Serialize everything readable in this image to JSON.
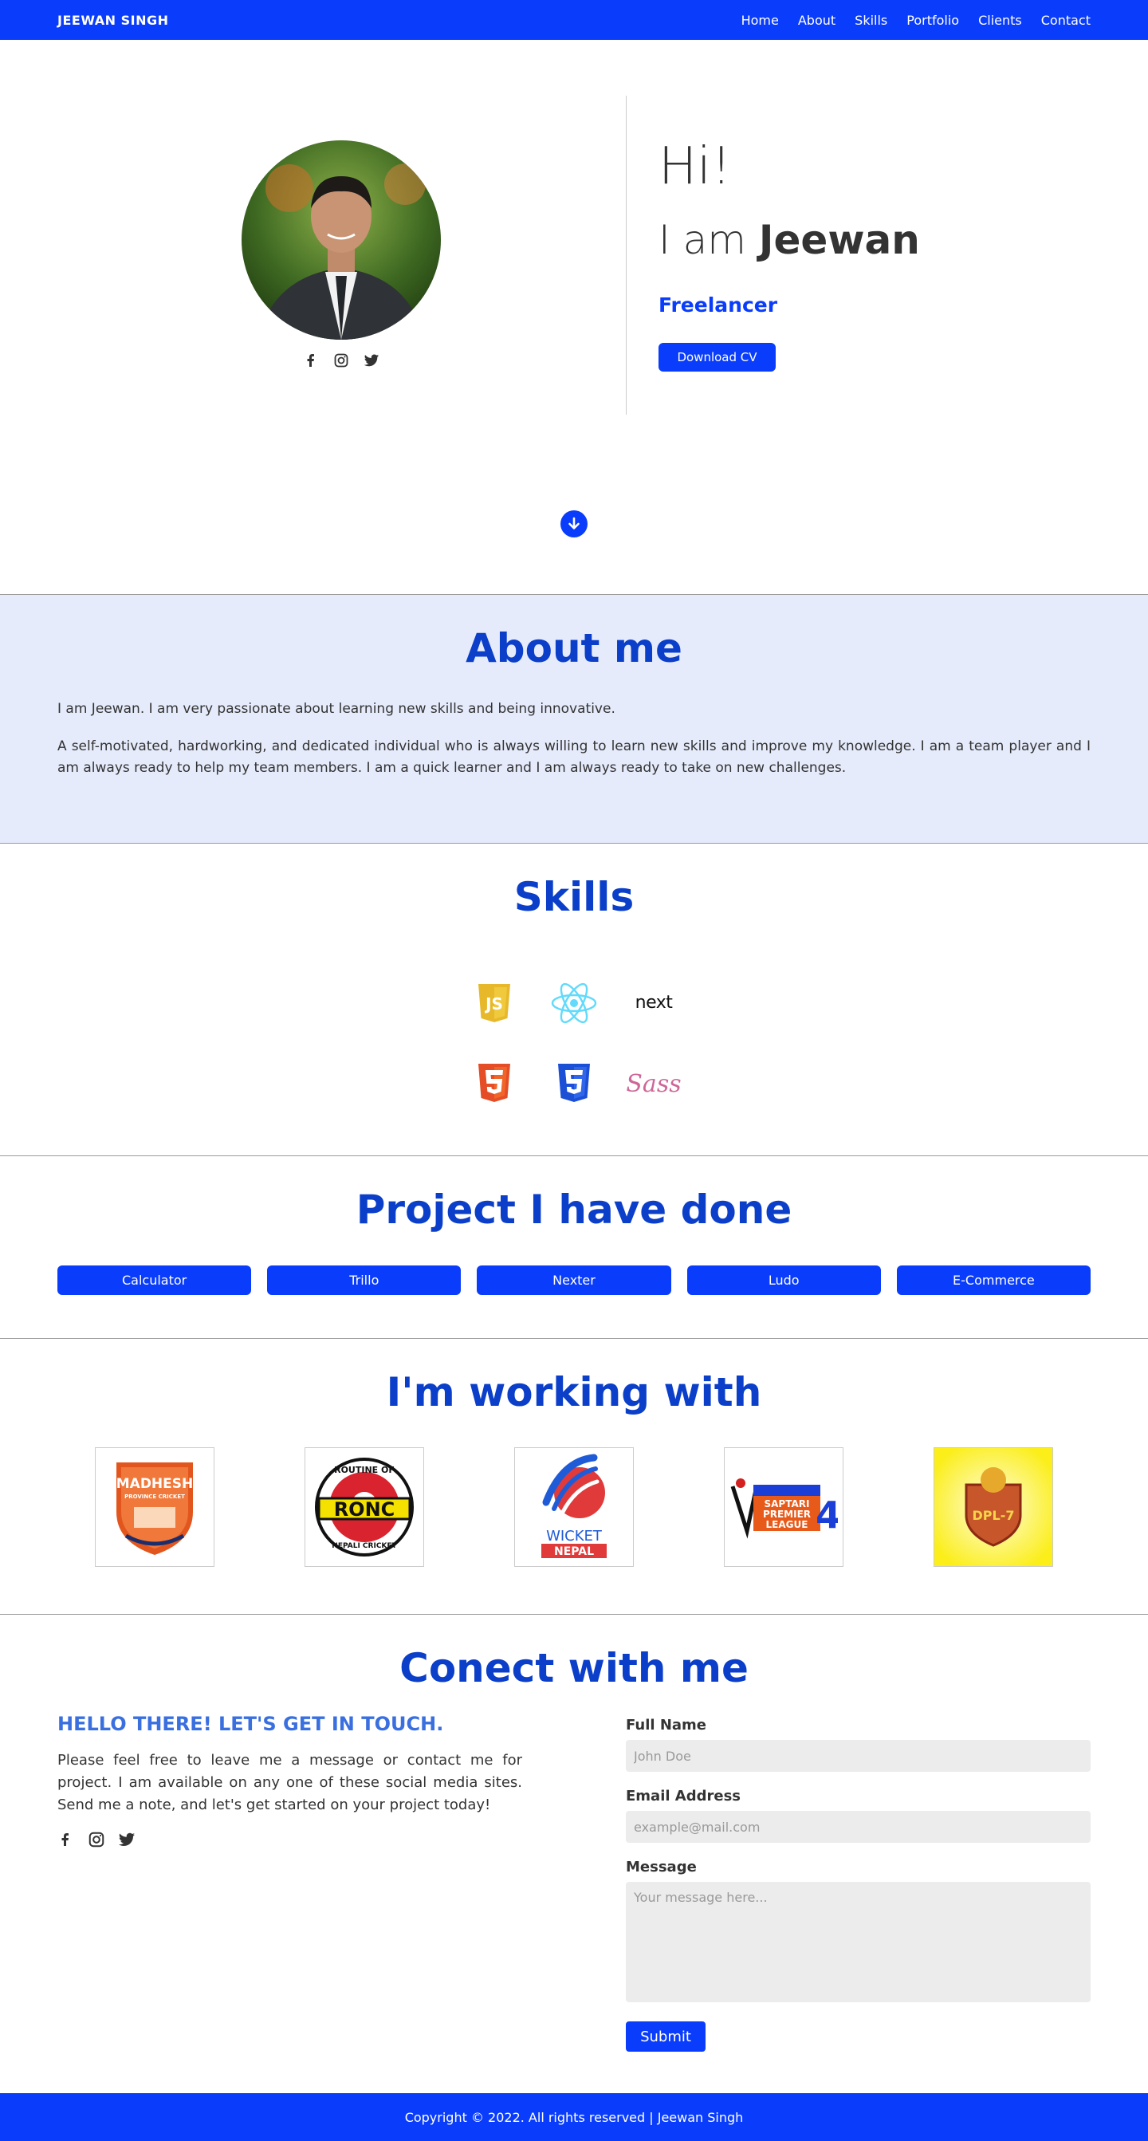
{
  "nav": {
    "brand": "JEEWAN SINGH",
    "links": [
      "Home",
      "About",
      "Skills",
      "Portfolio",
      "Clients",
      "Contact"
    ]
  },
  "hero": {
    "greeting": "Hi!",
    "intro": "I am",
    "name": "Jeewan",
    "role": "Freelancer",
    "cv_button": "Download CV",
    "social_icons": [
      "facebook-icon",
      "instagram-icon",
      "twitter-icon"
    ]
  },
  "about": {
    "title": "About me",
    "p1": "I am Jeewan. I am very passionate about learning new skills and being innovative.",
    "p2": "A self-motivated, hardworking, and dedicated individual who is always willing to learn new skills and improve my knowledge. I am a team player and I am always ready to help my team members. I am a quick learner and I am always ready to take on new challenges."
  },
  "skills": {
    "title": "Skills",
    "items": [
      "javascript-icon",
      "react-icon",
      "nextjs-icon",
      "html5-icon",
      "css3-icon",
      "sass-icon"
    ],
    "next_label": "next",
    "sass_label": "Sass"
  },
  "projects": {
    "title": "Project I have done",
    "items": [
      "Calculator",
      "Trillo",
      "Nexter",
      "Ludo",
      "E-Commerce"
    ]
  },
  "clients": {
    "title": "I'm working with",
    "logos": {
      "madhesh": [
        "MADHESH",
        "PROVINCE CRICKET"
      ],
      "ronc": [
        "ROUTINE OF",
        "RONC",
        "NEPALI CRICKET"
      ],
      "wicket": [
        "WICKET",
        "NEPAL"
      ],
      "saptari": [
        "SAPTARI",
        "PREMIER",
        "LEAGUE",
        "4"
      ],
      "dpl": "DPL-7"
    }
  },
  "contact": {
    "title": "Conect with me",
    "heading": "HELLO THERE! LET'S GET IN TOUCH.",
    "text": "Please feel free to leave me a message or contact me for project. I am available on any one of these social media sites. Send me a note, and let's get started on your project today!",
    "form": {
      "name_label": "Full Name",
      "name_placeholder": "John Doe",
      "email_label": "Email Address",
      "email_placeholder": "example@mail.com",
      "message_label": "Message",
      "message_placeholder": "Your message here...",
      "submit": "Submit"
    }
  },
  "footer": {
    "text": "Copyright © 2022. All rights reserved | Jeewan Singh"
  },
  "colors": {
    "primary": "#0a3dfb",
    "title": "#0b3fc9",
    "about_bg": "#e5ebfb"
  }
}
